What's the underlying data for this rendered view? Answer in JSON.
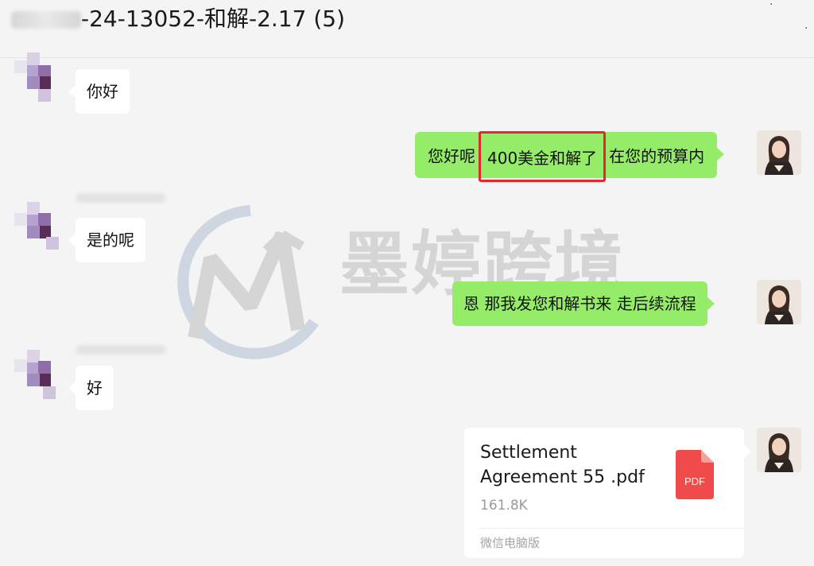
{
  "header": {
    "title": "-24-13052-和解-2.17 (5)"
  },
  "messages": [
    {
      "side": "in",
      "text": "你好"
    },
    {
      "side": "out",
      "before": "您好呢",
      "highlight": "400美金和解了",
      "after": "在您的预算内"
    },
    {
      "side": "in",
      "text": "是的呢"
    },
    {
      "side": "out",
      "text": "恩 那我发您和解书来 走后续流程"
    },
    {
      "side": "in",
      "text": "好"
    }
  ],
  "file": {
    "name_line1": "Settlement",
    "name_line2": "Agreement 55 .pdf",
    "size": "161.8K",
    "source": "微信电脑版",
    "icon_label": "PDF",
    "icon": "pdf-file-icon"
  },
  "watermark": {
    "text": "墨婷跨境"
  },
  "colors": {
    "out_bubble": "#95ec69",
    "in_bubble": "#ffffff",
    "highlight_box": "#e5262b",
    "pdf_icon": "#f04b4b",
    "background": "#f4f4f4"
  }
}
